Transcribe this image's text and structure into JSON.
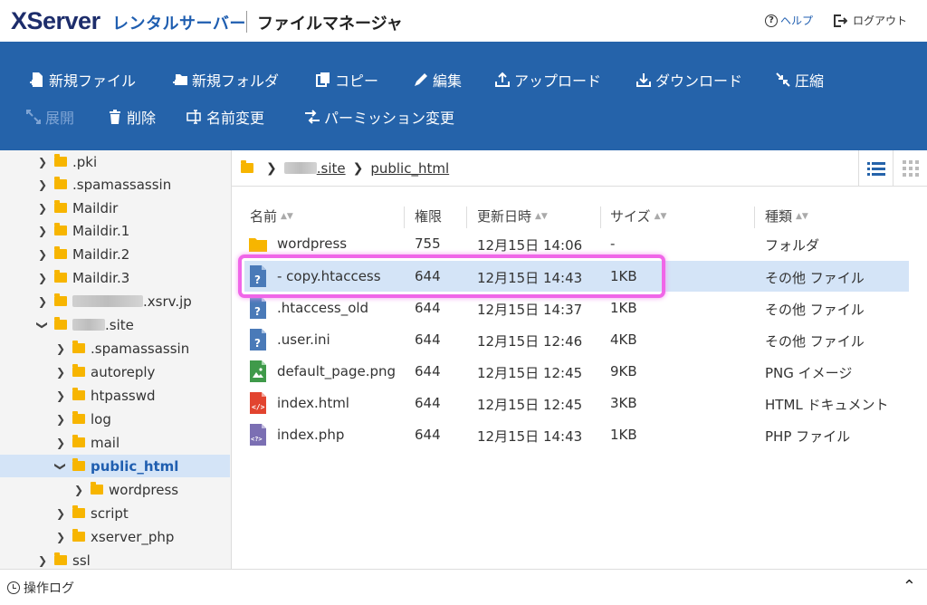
{
  "header": {
    "logo": "XServer",
    "logo_sub": "レンタルサーバー",
    "title": "ファイルマネージャ",
    "help_label": "ヘルプ",
    "logout_label": "ログアウト"
  },
  "toolbar": {
    "new_file": "新規ファイル",
    "new_folder": "新規フォルダ",
    "copy": "コピー",
    "edit": "編集",
    "upload": "アップロード",
    "download": "ダウンロード",
    "compress": "圧縮",
    "extract": "展開",
    "delete": "削除",
    "rename": "名前変更",
    "permission": "パーミッション変更"
  },
  "sidebar": {
    "items": [
      {
        "label": ".pki"
      },
      {
        "label": ".spamassassin"
      },
      {
        "label": "Maildir"
      },
      {
        "label": "Maildir.1"
      },
      {
        "label": "Maildir.2"
      },
      {
        "label": "Maildir.3"
      },
      {
        "label": ".xsrv.jp"
      },
      {
        "label": ".site"
      },
      {
        "label": ".spamassassin"
      },
      {
        "label": "autoreply"
      },
      {
        "label": "htpasswd"
      },
      {
        "label": "log"
      },
      {
        "label": "mail"
      },
      {
        "label": "public_html"
      },
      {
        "label": "wordpress"
      },
      {
        "label": "script"
      },
      {
        "label": "xserver_php"
      },
      {
        "label": "ssl"
      }
    ]
  },
  "breadcrumb": {
    "site": ".site",
    "current": "public_html"
  },
  "table": {
    "headers": {
      "name": "名前",
      "perm": "権限",
      "date": "更新日時",
      "size": "サイズ",
      "type": "種類"
    },
    "rows": [
      {
        "name": "wordpress",
        "perm": "755",
        "date": "12月15日 14:06",
        "size": "-",
        "type": "フォルダ",
        "icon": "folder-icon"
      },
      {
        "name": "- copy.htaccess",
        "perm": "644",
        "date": "12月15日 14:43",
        "size": "1KB",
        "type": "その他 ファイル",
        "icon": "unknown-file-icon"
      },
      {
        "name": ".htaccess_old",
        "perm": "644",
        "date": "12月15日 14:37",
        "size": "1KB",
        "type": "その他 ファイル",
        "icon": "unknown-file-icon"
      },
      {
        "name": ".user.ini",
        "perm": "644",
        "date": "12月15日 12:46",
        "size": "4KB",
        "type": "その他 ファイル",
        "icon": "unknown-file-icon"
      },
      {
        "name": "default_page.png",
        "perm": "644",
        "date": "12月15日 12:45",
        "size": "9KB",
        "type": "PNG イメージ",
        "icon": "image-file-icon"
      },
      {
        "name": "index.html",
        "perm": "644",
        "date": "12月15日 12:45",
        "size": "3KB",
        "type": "HTML ドキュメント",
        "icon": "html-file-icon"
      },
      {
        "name": "index.php",
        "perm": "644",
        "date": "12月15日 14:43",
        "size": "1KB",
        "type": "PHP ファイル",
        "icon": "php-file-icon"
      }
    ]
  },
  "bottombar": {
    "label": "操作ログ"
  },
  "colors": {
    "toolbar_bg": "#2563aa",
    "selection_bg": "#d4e4f7",
    "highlight": "#f066e8",
    "folder": "#f7b500"
  }
}
